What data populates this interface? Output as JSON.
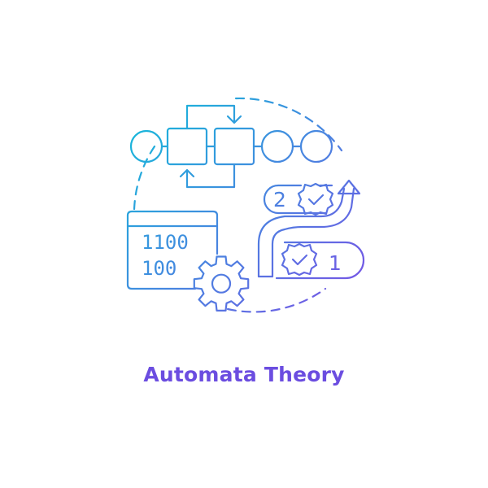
{
  "caption": "Automata Theory",
  "binary": {
    "line1": "1100",
    "line2": "100"
  },
  "steps": {
    "upper": "2",
    "lower": "1"
  },
  "colors": {
    "gradient_start": "#16b8da",
    "gradient_end": "#7a52e6",
    "caption": "#6b4de0"
  },
  "icons": [
    "state-machine-icon",
    "binary-window-icon",
    "gear-icon",
    "check-badge-icon",
    "arrow-road-icon"
  ]
}
